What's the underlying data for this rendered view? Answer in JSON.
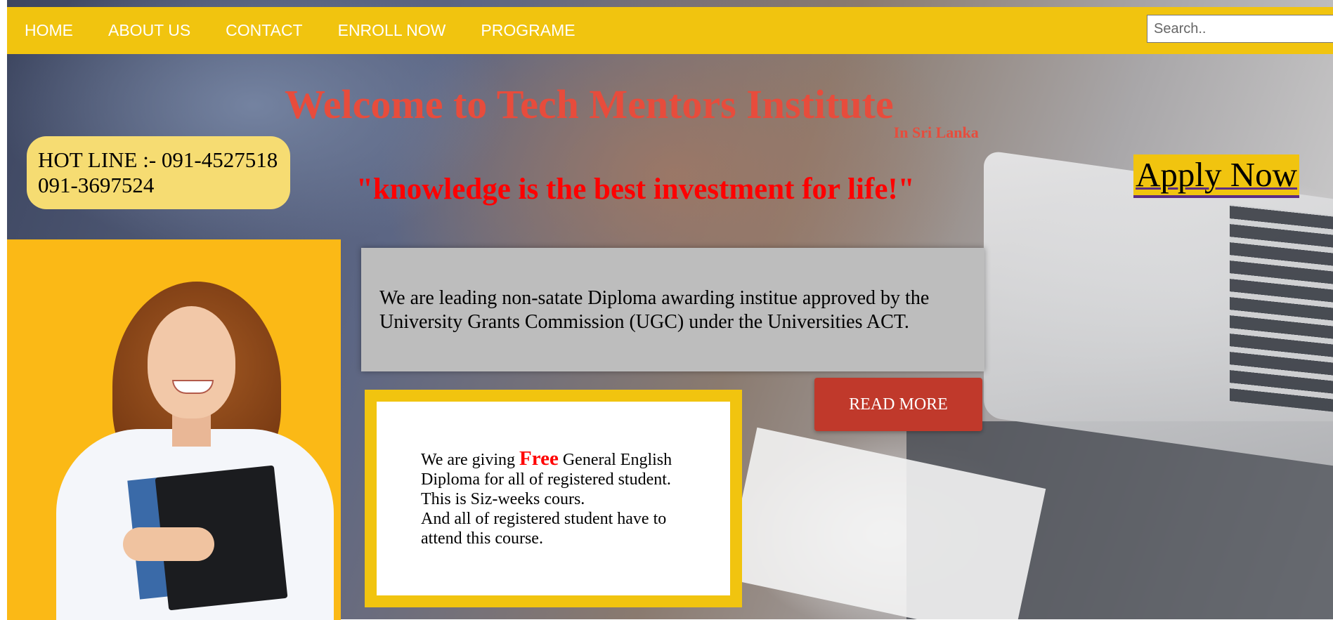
{
  "nav": {
    "items": [
      {
        "label": "HOME"
      },
      {
        "label": "ABOUT US"
      },
      {
        "label": "CONTACT"
      },
      {
        "label": "ENROLL NOW"
      },
      {
        "label": "PROGRAME"
      }
    ],
    "search_placeholder": "Search.."
  },
  "hero": {
    "title": "Welcome to Tech Mentors Institute",
    "title_sub": "In Sri Lanka",
    "quote": "\"knowledge is the best investment for life!\"",
    "hotline_line1": "HOT LINE :- 091-4527518",
    "hotline_line2": "091-3697524",
    "apply_label": "Apply Now"
  },
  "info": {
    "text": "We are leading non-satate Diploma awarding institue approved by the University Grants Commission (UGC) under the Universities ACT.",
    "read_more_label": "READ MORE"
  },
  "free_box": {
    "before": "We are giving ",
    "highlight": "Free",
    "after": " General English Diploma for all of registered student.",
    "line2": "This is Siz-weeks cours.",
    "line3": "And all of registered student have to attend this course."
  },
  "colors": {
    "nav_bg": "#f1c40f",
    "title": "#e74c3c",
    "quote": "#ff0000",
    "hotline_bg": "#f6dc72",
    "read_more_bg": "#c0392b",
    "info_bg": "#bdbdbd"
  }
}
